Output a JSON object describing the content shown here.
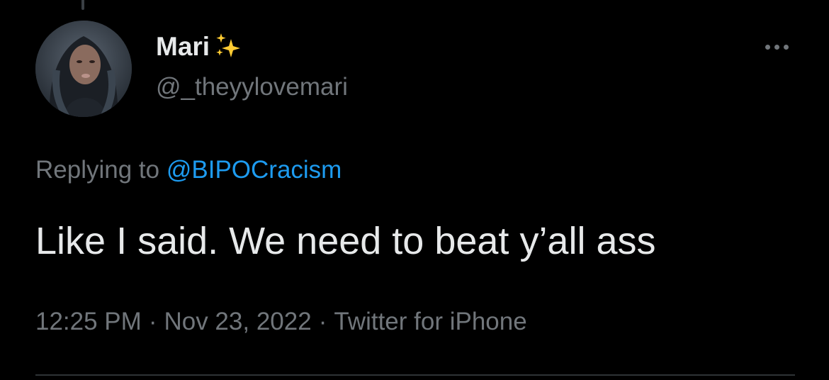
{
  "tweet": {
    "display_name": "Mari",
    "name_emoji": "sparkles-icon",
    "handle": "@_theyylovemari",
    "replying_prefix": "Replying to",
    "replying_to": "@BIPOCracism",
    "text": "Like I said. We need to beat y’all ass",
    "time": "12:25 PM",
    "separator": "·",
    "date": "Nov 23, 2022",
    "source": "Twitter for iPhone"
  },
  "colors": {
    "background": "#000000",
    "primary_text": "#e7e9ea",
    "secondary_text": "#71767b",
    "link": "#1d9bf0",
    "divider": "#2f3336",
    "sparkle": "#ffcc33"
  }
}
